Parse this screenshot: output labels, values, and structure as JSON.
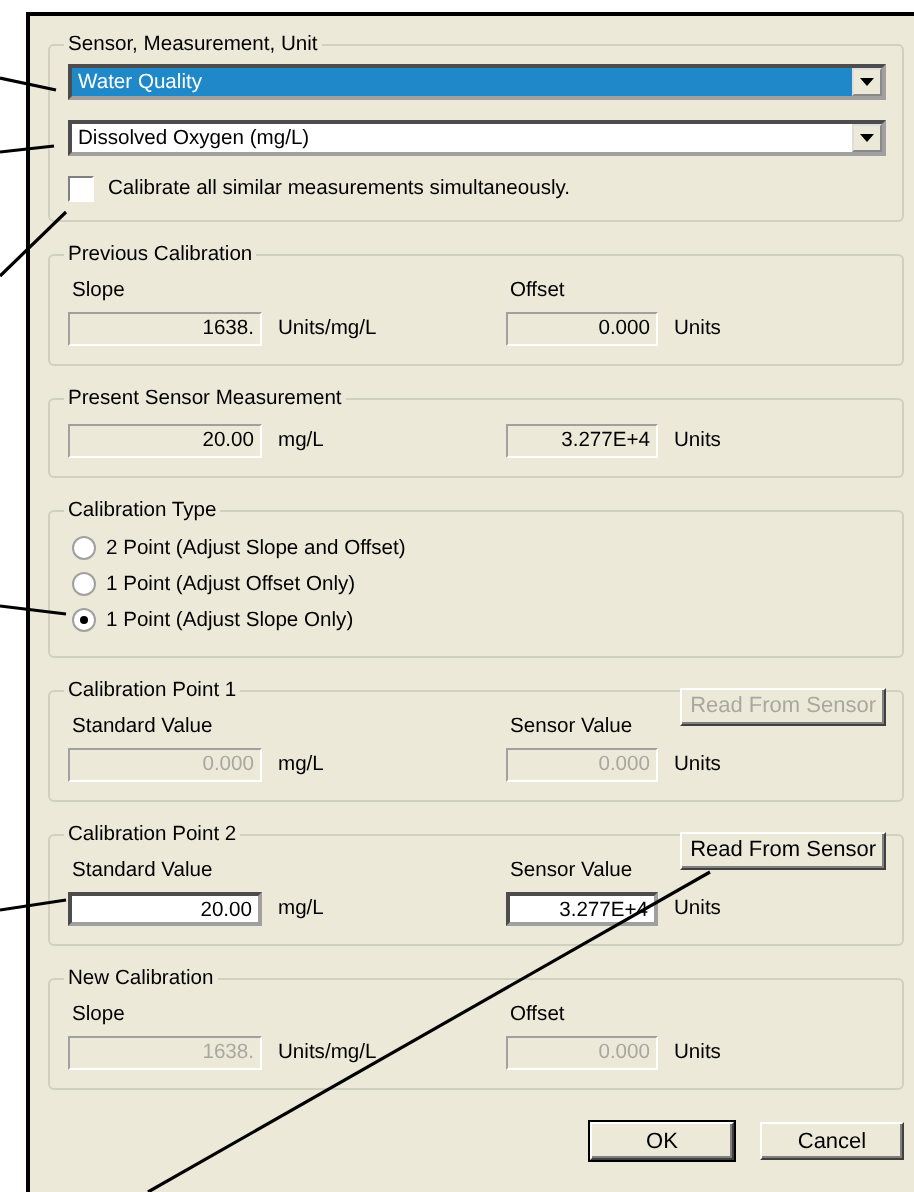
{
  "sensor_group": {
    "title": "Sensor, Measurement, Unit",
    "dropdowns": [
      {
        "value": "Water Quality",
        "highlighted": true
      },
      {
        "value": "Dissolved Oxygen (mg/L)",
        "highlighted": false
      }
    ],
    "checkbox": {
      "label": "Calibrate all similar measurements simultaneously.",
      "checked": false
    }
  },
  "groups": [
    {
      "kind": "pair",
      "title": "Previous Calibration",
      "left": {
        "label": "Slope",
        "value": "1638.",
        "unit": "Units/mg/L",
        "editable": false,
        "disabled": false
      },
      "right": {
        "label": "Offset",
        "value": "0.000",
        "unit": "Units",
        "editable": false,
        "disabled": false
      }
    },
    {
      "kind": "pair",
      "title": "Present Sensor Measurement",
      "left": {
        "value": "20.00",
        "unit": "mg/L",
        "editable": false,
        "disabled": false
      },
      "right": {
        "value": "3.277E+4",
        "unit": "Units",
        "editable": false,
        "disabled": false
      }
    },
    {
      "kind": "radios",
      "title": "Calibration Type",
      "options": [
        {
          "label": "2 Point (Adjust Slope and Offset)",
          "selected": false
        },
        {
          "label": "1 Point (Adjust Offset Only)",
          "selected": false
        },
        {
          "label": "1 Point (Adjust Slope Only)",
          "selected": true
        }
      ]
    },
    {
      "kind": "pair",
      "title": "Calibration Point 1",
      "button": {
        "label": "Read From Sensor",
        "disabled": true
      },
      "left": {
        "label": "Standard Value",
        "value": "0.000",
        "unit": "mg/L",
        "editable": false,
        "disabled": true
      },
      "right": {
        "label": "Sensor Value",
        "value": "0.000",
        "unit": "Units",
        "editable": false,
        "disabled": true
      }
    },
    {
      "kind": "pair",
      "title": "Calibration Point 2",
      "button": {
        "label": "Read From Sensor",
        "disabled": false
      },
      "left": {
        "label": "Standard Value",
        "value": "20.00",
        "unit": "mg/L",
        "editable": true,
        "disabled": false
      },
      "right": {
        "label": "Sensor Value",
        "value": "3.277E+4",
        "unit": "Units",
        "editable": true,
        "disabled": false
      }
    },
    {
      "kind": "pair",
      "title": "New Calibration",
      "left": {
        "label": "Slope",
        "value": "1638.",
        "unit": "Units/mg/L",
        "editable": false,
        "disabled": true
      },
      "right": {
        "label": "Offset",
        "value": "0.000",
        "unit": "Units",
        "editable": false,
        "disabled": true
      }
    }
  ],
  "buttons": [
    {
      "label": "OK",
      "default": true
    },
    {
      "label": "Cancel",
      "default": false
    }
  ]
}
